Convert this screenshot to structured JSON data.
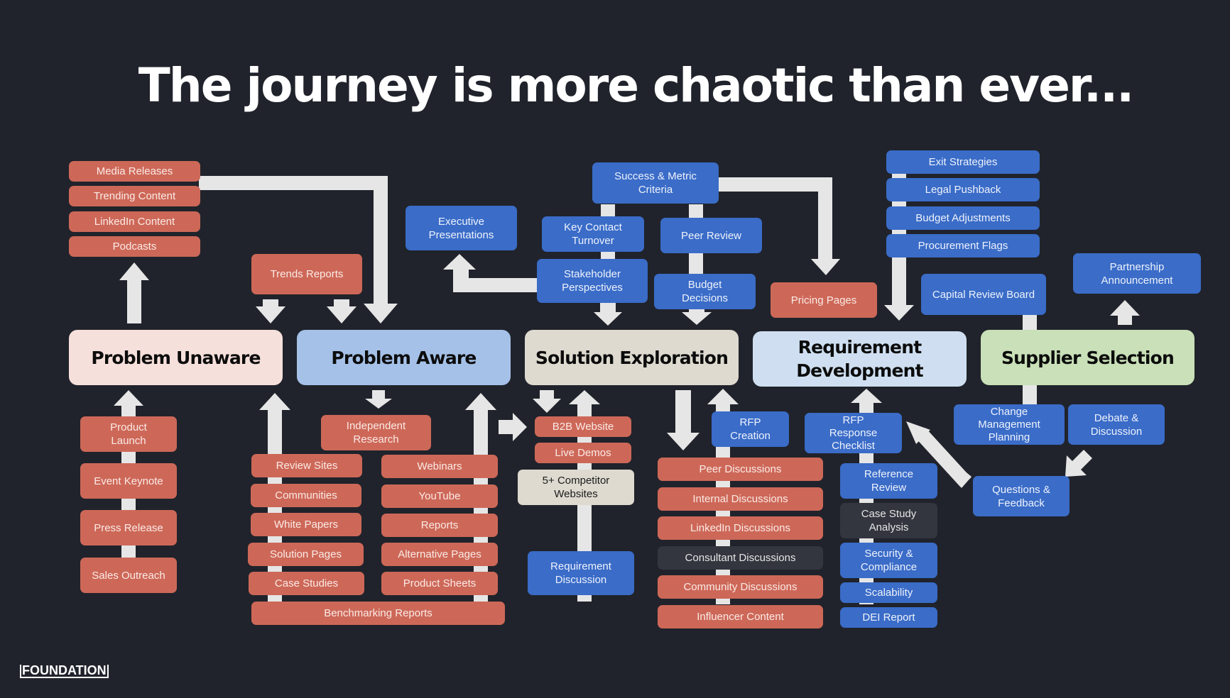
{
  "title": "The journey is more chaotic than ever...",
  "logo": "FOUNDATION",
  "colors": {
    "background": "#20232b",
    "channel_red": "#cd6858",
    "channel_blue": "#3a6cc8",
    "channel_dark": "#33363f",
    "channel_beige": "#dedad0",
    "arrow": "#e6e6e6"
  },
  "stages": [
    {
      "label": "Problem Unaware",
      "color": "#f6e0dc"
    },
    {
      "label": "Problem Aware",
      "color": "#a5c1e8"
    },
    {
      "label": "Solution Exploration",
      "color": "#dedad0"
    },
    {
      "label": "Requirement Development",
      "color": "#cfdff1"
    },
    {
      "label": "Supplier Selection",
      "color": "#c9e0b8"
    }
  ],
  "problem_unaware": {
    "above": [
      "Media Releases",
      "Trending Content",
      "LinkedIn Content",
      "Podcasts"
    ],
    "below": [
      "Product Launch",
      "Event Keynote",
      "Press Release",
      "Sales Outreach"
    ]
  },
  "problem_aware": {
    "above": [
      "Trends Reports"
    ],
    "independent_research": "Independent Research",
    "left_column": [
      "Review Sites",
      "Communities",
      "White Papers",
      "Solution Pages",
      "Case Studies"
    ],
    "right_column": [
      "Webinars",
      "YouTube",
      "Reports",
      "Alternative Pages",
      "Product Sheets"
    ],
    "footer": "Benchmarking Reports"
  },
  "solution_exploration": {
    "above": {
      "success_metric": "Success & Metric Criteria",
      "executive": "Executive Presentations",
      "key_contact": "Key Contact Turnover",
      "stakeholder": "Stakeholder Perspectives",
      "peer_review": "Peer Review",
      "budget": "Budget Decisions"
    },
    "below": [
      "B2B Website",
      "Live Demos",
      "5+ Competitor Websites",
      "Requirement Discussion"
    ]
  },
  "requirement_development": {
    "above": {
      "pricing": "Pricing Pages",
      "stack": [
        "Exit Strategies",
        "Legal Pushback",
        "Budget Adjustments",
        "Procurement Flags"
      ]
    },
    "discussions": [
      "Peer Discussions",
      "Internal Discussions",
      "LinkedIn Discussions",
      "Consultant Discussions",
      "Community Discussions",
      "Influencer Content"
    ],
    "rfp_creation": "RFP Creation",
    "rfp_checklist": "RFP Response Checklist",
    "checklist_items": [
      "Reference Review",
      "Case Study Analysis",
      "Security & Compliance",
      "Scalability",
      "DEI Report"
    ]
  },
  "supplier_selection": {
    "above": [
      "Capital Review Board",
      "Partnership Announcement"
    ],
    "below": [
      "Change Management Planning",
      "Debate & Discussion",
      "Questions & Feedback"
    ]
  }
}
